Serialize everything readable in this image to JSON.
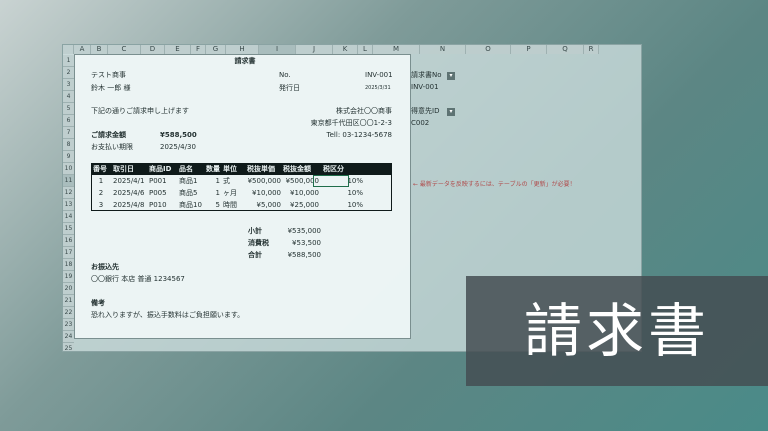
{
  "columns": [
    "A",
    "B",
    "C",
    "D",
    "E",
    "F",
    "G",
    "H",
    "I",
    "J",
    "K",
    "L",
    "M",
    "N",
    "O",
    "P",
    "Q",
    "R"
  ],
  "rows": [
    "1",
    "2",
    "3",
    "4",
    "5",
    "6",
    "7",
    "8",
    "9",
    "10",
    "11",
    "12",
    "13",
    "14",
    "15",
    "16",
    "17",
    "18",
    "19",
    "20",
    "21",
    "22",
    "23",
    "24",
    "25"
  ],
  "invoice": {
    "title": "請求書",
    "client": "テスト商事",
    "recipient": "鈴木 一郎 様",
    "no_label": "No.",
    "no_value": "INV-001",
    "issue_label": "発行日",
    "issue_value": "2025/3/31",
    "greeting": "下記の通りご請求申し上げます",
    "company": "株式会社〇〇商事",
    "address": "東京都千代田区〇〇1-2-3",
    "tel": "Tell: 03-1234-5678",
    "amount_label": "ご請求金額",
    "amount_value": "¥588,500",
    "due_label": "お支払い期限",
    "due_value": "2025/4/30",
    "table_headers": [
      "番号",
      "取引日",
      "商品ID",
      "品名",
      "数量",
      "単位",
      "税抜単価",
      "税抜金額",
      "税区分"
    ],
    "table_rows": [
      [
        "1",
        "2025/4/1",
        "P001",
        "商品1",
        "1",
        "式",
        "¥500,000",
        "¥500,000",
        "10%"
      ],
      [
        "2",
        "2025/4/6",
        "P005",
        "商品5",
        "1",
        "ヶ月",
        "¥10,000",
        "¥10,000",
        "10%"
      ],
      [
        "3",
        "2025/4/8",
        "P010",
        "商品10",
        "5",
        "時間",
        "¥5,000",
        "¥25,000",
        "10%"
      ]
    ],
    "subtotal_label": "小計",
    "subtotal_value": "¥535,000",
    "tax_label": "消費税",
    "tax_value": "¥53,500",
    "total_label": "合計",
    "total_value": "¥588,500",
    "bank_label": "お振込先",
    "bank_value": "〇〇銀行 本店 普通 1234567",
    "remarks_label": "備考",
    "remarks_value": "恐れ入りますが、振込手数料はご負担願います。"
  },
  "side": {
    "invoice_no_label": "請求書No",
    "invoice_no_value": "INV-001",
    "client_id_label": "得意先ID",
    "client_id_value": "C002",
    "dropdown_icon": "▾",
    "note": "← 最新データを反映するには、テーブルの「更新」が必要！"
  },
  "overlay_title": "請求書"
}
